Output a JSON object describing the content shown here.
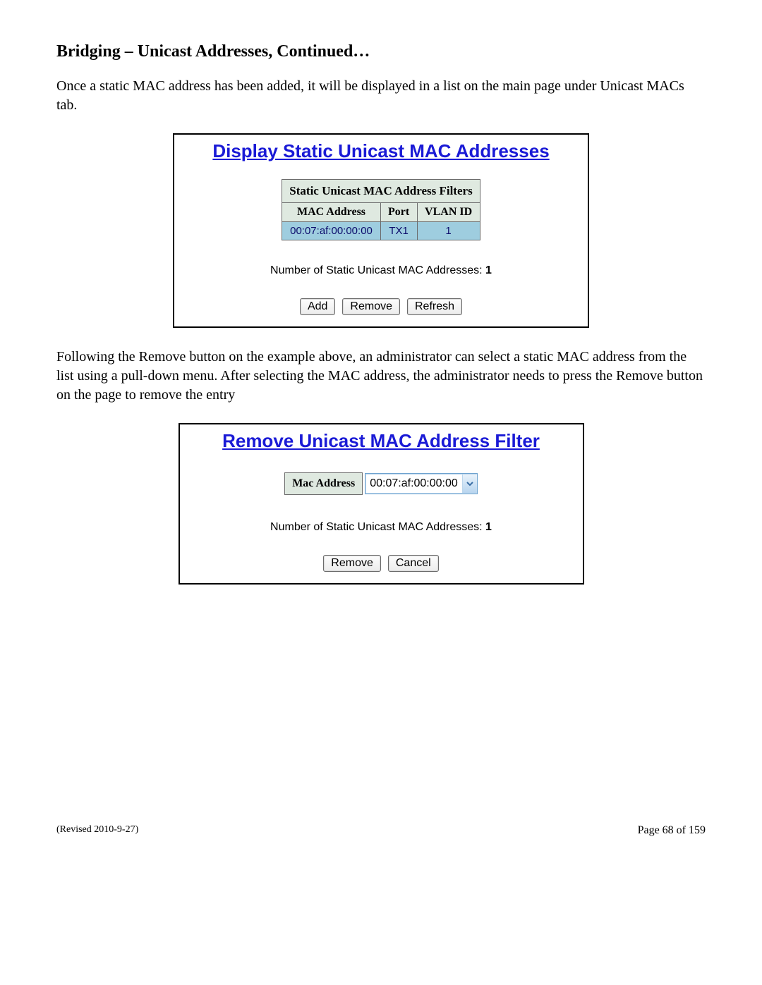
{
  "heading": "Bridging – Unicast Addresses, Continued…",
  "para1": "Once a static MAC address has been added, it will be displayed in a list on the main page under Unicast MACs tab.",
  "para2": "Following the Remove button on the example above, an administrator can select a static MAC address from the list using a pull-down menu.  After selecting the MAC address, the administrator needs to press the Remove button on the page to remove the entry",
  "panel1": {
    "title": "Display Static Unicast MAC Addresses",
    "table_caption": "Static Unicast MAC Address Filters",
    "headers": {
      "mac": "MAC Address",
      "port": "Port",
      "vlan": "VLAN ID"
    },
    "row": {
      "mac": "00:07:af:00:00:00",
      "port": "TX1",
      "vlan": "1"
    },
    "count_label": "Number of Static Unicast MAC Addresses: ",
    "count_value": "1",
    "buttons": {
      "add": "Add",
      "remove": "Remove",
      "refresh": "Refresh"
    }
  },
  "panel2": {
    "title": "Remove Unicast MAC Address Filter",
    "field_label": "Mac Address",
    "field_value": "00:07:af:00:00:00",
    "count_label": "Number of Static Unicast MAC Addresses: ",
    "count_value": "1",
    "buttons": {
      "remove": "Remove",
      "cancel": "Cancel"
    }
  },
  "footer": {
    "revised": "(Revised 2010-9-27)",
    "page": "Page 68 of 159"
  }
}
